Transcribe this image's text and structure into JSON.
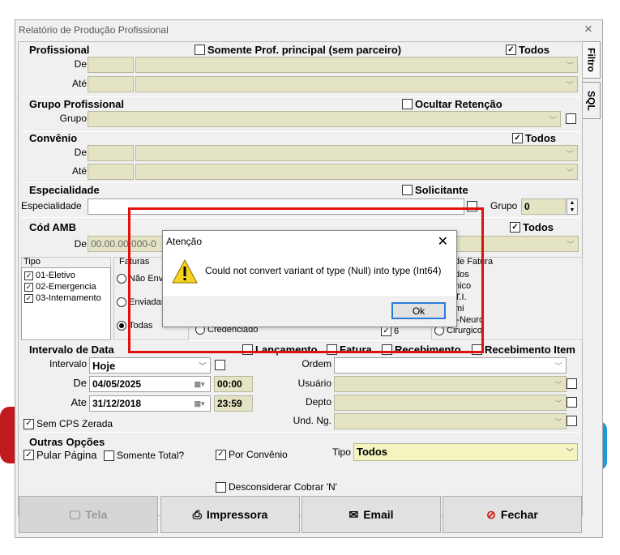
{
  "window": {
    "title": "Relatório de Produção Profissional",
    "close_icon": "×"
  },
  "tabs": {
    "filtro": "Filtro",
    "sql": "SQL"
  },
  "profissional": {
    "title": "Profissional",
    "somente_principal": "Somente Prof. principal (sem parceiro)",
    "todos": "Todos",
    "de_label": "De",
    "ate_label": "Até"
  },
  "grupo_profissional": {
    "title": "Grupo Profissional",
    "ocultar_retencao": "Ocultar Retenção",
    "grupo_label": "Grupo"
  },
  "convenio": {
    "title": "Convênio",
    "todos": "Todos",
    "de_label": "De",
    "ate_label": "Até"
  },
  "especialidade": {
    "title": "Especialidade",
    "solicitante": "Solicitante",
    "especialidade_label": "Especialidade",
    "grupo_label": "Grupo",
    "grupo_value": "0"
  },
  "cod_amb": {
    "title": "Cód AMB",
    "todos": "Todos",
    "de_label": "De",
    "de_value": "00.00.00.000-0"
  },
  "tipo": {
    "title": "Tipo",
    "items": [
      "01-Eletivo",
      "02-Emergencia",
      "03-Internamento"
    ]
  },
  "faturas": {
    "title": "Faturas",
    "options": [
      "Não Env",
      "Enviadas",
      "Todas"
    ],
    "credenciado": "Credenciado",
    "number_value": "6"
  },
  "tipo_fatura": {
    "title": "de Fatura",
    "options": [
      "dos",
      "nico",
      "T.I.",
      "mi",
      "l-Neuro",
      "Cirurgico"
    ]
  },
  "intervalo": {
    "title": "Intervalo  de Data",
    "lancamento": "Lançamento",
    "fatura": "Fatura",
    "recebimento": "Recebimento",
    "recebimento_item": "Recebimento Item",
    "intervalo_label": "Intervalo",
    "intervalo_value": "Hoje",
    "de_label": "De",
    "de_date": "04/05/2025",
    "de_time": "00:00",
    "ate_label": "Ate",
    "ate_date": "31/12/2018",
    "ate_time": "23:59",
    "sem_cps": "Sem CPS Zerada",
    "ordem_label": "Ordem",
    "usuario_label": "Usuário",
    "depto_label": "Depto",
    "und_label": "Und. Ng."
  },
  "outras": {
    "title": "Outras Opções",
    "pular_pagina": "Pular Página",
    "somente_total": "Somente Total?",
    "por_convenio": "Por Convênio",
    "tipo_label": "Tipo",
    "tipo_value": "Todos",
    "desconsiderar": "Desconsiderar Cobrar 'N'"
  },
  "buttons": {
    "tela": "Tela",
    "impressora": "Impressora",
    "email": "Email",
    "fechar": "Fechar"
  },
  "dialog": {
    "title": "Atenção",
    "message": "Could not convert variant of type (Null) into type (Int64)",
    "ok": "Ok",
    "icon": "warning-icon"
  },
  "colors": {
    "field_bg": "#e4e4c4",
    "highlight": "#e01010",
    "dialog_button_border": "#2b7bd8"
  }
}
